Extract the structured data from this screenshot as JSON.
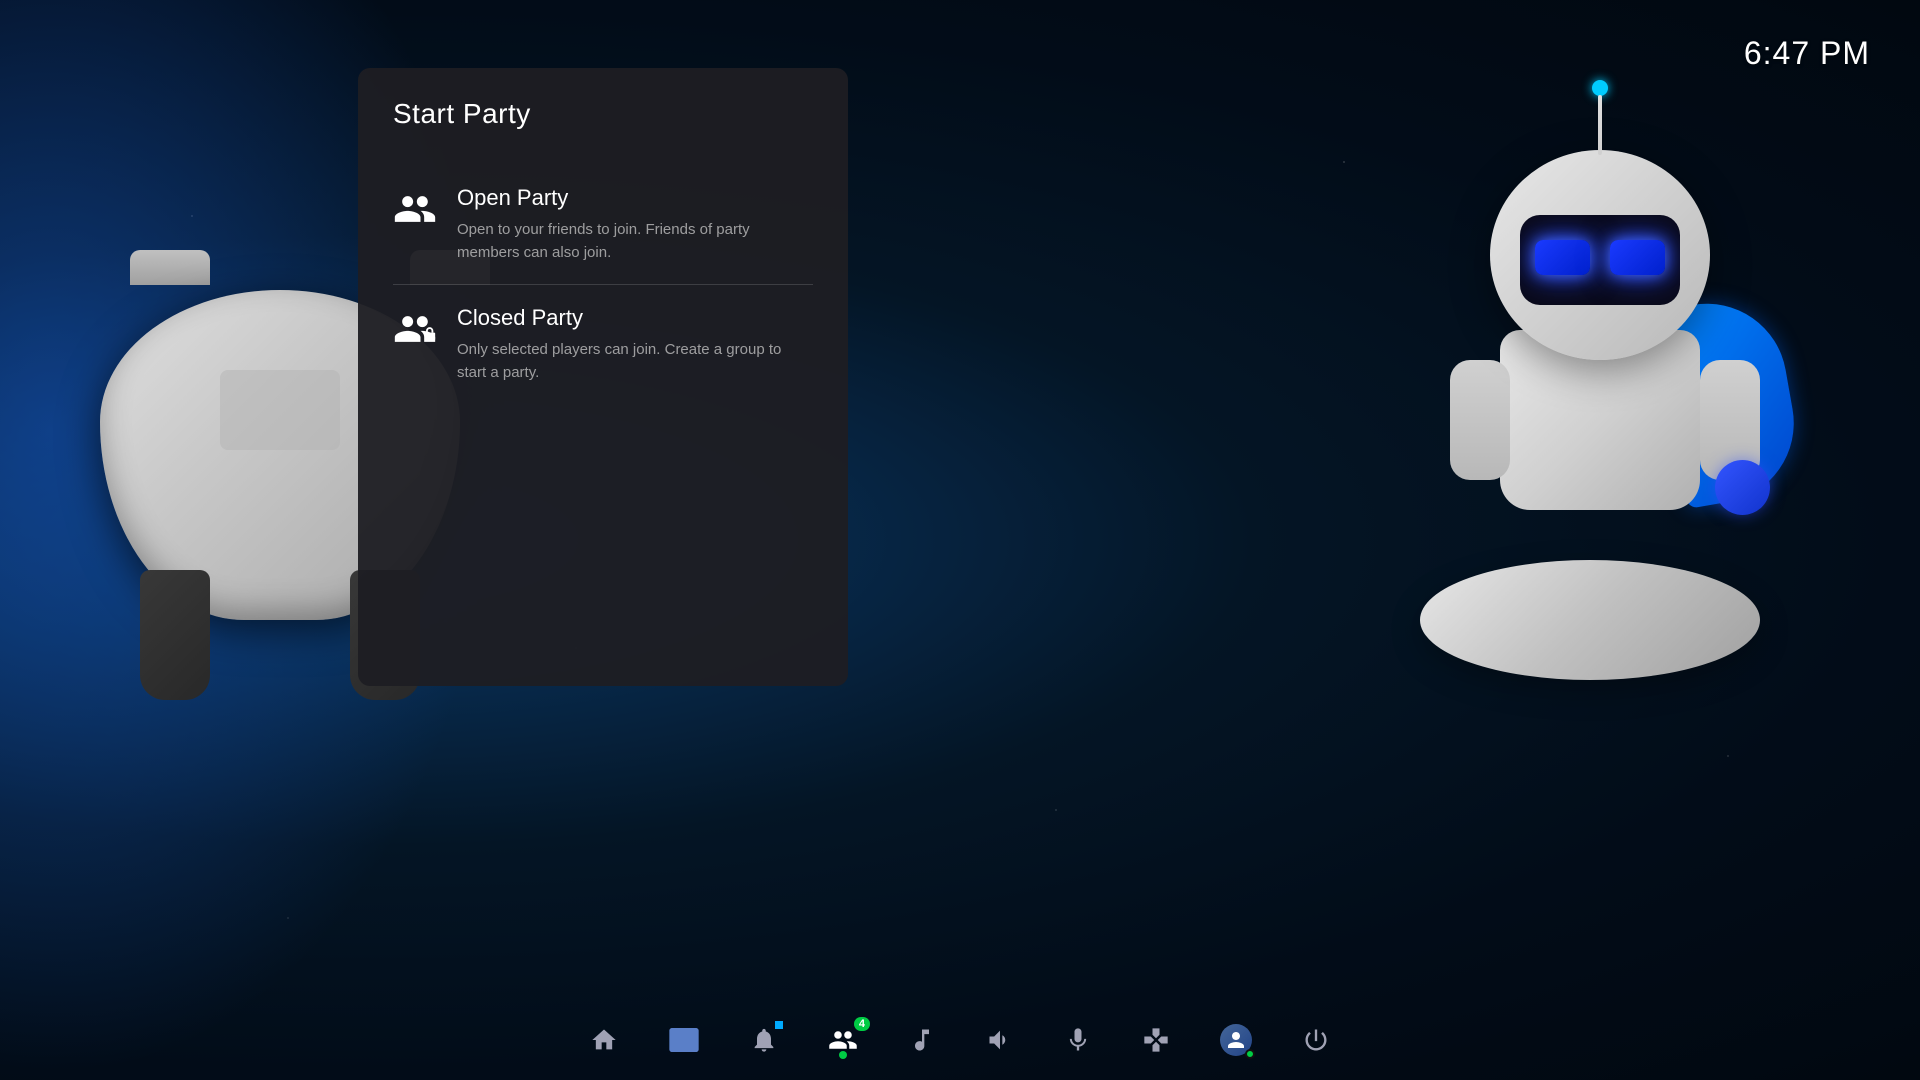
{
  "clock": {
    "time": "6:47 PM"
  },
  "dialog": {
    "title": "Start Party",
    "open_party": {
      "label": "Open Party",
      "description": "Open to your friends to join. Friends of party members can also join."
    },
    "closed_party": {
      "label": "Closed Party",
      "description": "Only selected players can join. Create a group to start a party."
    }
  },
  "taskbar": {
    "items": [
      {
        "name": "home",
        "label": "Home"
      },
      {
        "name": "game",
        "label": "Game"
      },
      {
        "name": "notifications",
        "label": "Notifications"
      },
      {
        "name": "friends",
        "label": "Friends",
        "badge": "4",
        "active": true
      },
      {
        "name": "music",
        "label": "Music"
      },
      {
        "name": "sound",
        "label": "Sound"
      },
      {
        "name": "mic",
        "label": "Microphone"
      },
      {
        "name": "controller",
        "label": "Controller"
      },
      {
        "name": "account",
        "label": "Account"
      },
      {
        "name": "power",
        "label": "Power"
      }
    ]
  }
}
